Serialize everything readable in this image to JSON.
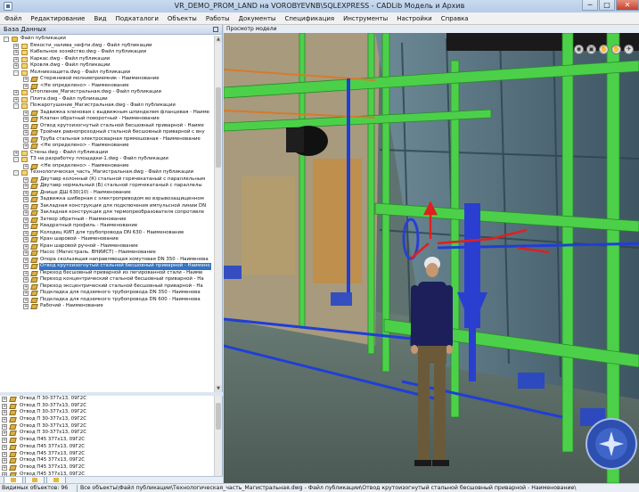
{
  "window": {
    "title": "VR_DEMO_PROM_LAND на VOROBYEVNB\\SQLEXPRESS - CADLib Модель и Архив",
    "controls": [
      "─",
      "□",
      "✕"
    ]
  },
  "menu": [
    "Файл",
    "Редактирование",
    "Вид",
    "Подкаталоги",
    "Объекты",
    "Работы",
    "Документы",
    "Спецификация",
    "Инструменты",
    "Настройки",
    "Справка"
  ],
  "left_panel": {
    "title": "База Данных",
    "tree": [
      {
        "level": 0,
        "icon": "folder",
        "exp": "-",
        "label": "Файл публикации"
      },
      {
        "level": 1,
        "icon": "dwg",
        "exp": "+",
        "label": "Емкости_налива_нефти.dwg - Файл публикации"
      },
      {
        "level": 1,
        "icon": "dwg",
        "exp": "+",
        "label": "Кабельное хозяйство.dwg - Файл публикации"
      },
      {
        "level": 1,
        "icon": "dwg",
        "exp": "+",
        "label": "Каркас.dwg - Файл публикации"
      },
      {
        "level": 1,
        "icon": "dwg",
        "exp": "+",
        "label": "Кровля.dwg - Файл публикации"
      },
      {
        "level": 1,
        "icon": "dwg",
        "exp": "-",
        "label": "Молниезащита.dwg - Файл публикации"
      },
      {
        "level": 2,
        "icon": "part",
        "exp": "+",
        "label": "Стержневой молниеприемник - Наименование"
      },
      {
        "level": 2,
        "icon": "part",
        "exp": "+",
        "label": "<Не определено> - Наименование"
      },
      {
        "level": 1,
        "icon": "dwg",
        "exp": "+",
        "label": "Отопление_Магистральная.dwg - Файл публикации"
      },
      {
        "level": 1,
        "icon": "dwg",
        "exp": "+",
        "label": "Плита.dwg - Файл публикации"
      },
      {
        "level": 1,
        "icon": "dwg",
        "exp": "-",
        "label": "Пожаротушение_Магистральная.dwg - Файл публикации"
      },
      {
        "level": 2,
        "icon": "part",
        "exp": "+",
        "label": "Задвижка клиновая с выдвижным шпинделем фланцевая - Наиме"
      },
      {
        "level": 2,
        "icon": "part",
        "exp": "+",
        "label": "Клапан обратный поворотный - Наименование"
      },
      {
        "level": 2,
        "icon": "part",
        "exp": "+",
        "label": "Отвод крутоизогнутый стальной бесшовный приварной - Наиме"
      },
      {
        "level": 2,
        "icon": "part",
        "exp": "+",
        "label": "Тройник равнопроходный стальной бесшовный приварной с вну"
      },
      {
        "level": 2,
        "icon": "part",
        "exp": "+",
        "label": "Труба стальная электросварная прямошовная - Наименование"
      },
      {
        "level": 2,
        "icon": "part",
        "exp": "+",
        "label": "<Не определено> - Наименование"
      },
      {
        "level": 1,
        "icon": "dwg",
        "exp": "+",
        "label": "Стены.dwg - Файл публикации"
      },
      {
        "level": 1,
        "icon": "dwg",
        "exp": "-",
        "label": "ТЗ на разработку площадки-1.dwg - Файл публикации"
      },
      {
        "level": 2,
        "icon": "part",
        "exp": "+",
        "label": "<Не определено> - Наименование"
      },
      {
        "level": 1,
        "icon": "dwg",
        "exp": "-",
        "label": "Технологическая_часть_Магистральная.dwg - Файл публикации"
      },
      {
        "level": 2,
        "icon": "part",
        "exp": "+",
        "label": "Двутавр колонный (К) стальной горячекатаный с параллельным"
      },
      {
        "level": 2,
        "icon": "part",
        "exp": "+",
        "label": "Двутавр нормальный (Б) стальной горячекатаный с параллелы"
      },
      {
        "level": 2,
        "icon": "part",
        "exp": "+",
        "label": "Днище ДШ 630(10) - Наименование"
      },
      {
        "level": 2,
        "icon": "part",
        "exp": "+",
        "label": "Задвижка шиберная с электроприводом во взрывозащищенном"
      },
      {
        "level": 2,
        "icon": "part",
        "exp": "+",
        "label": "Закладная конструкция для подключения импульсной линии DN"
      },
      {
        "level": 2,
        "icon": "part",
        "exp": "+",
        "label": "Закладная конструкция для термопреобразователя сопротивле"
      },
      {
        "level": 2,
        "icon": "part",
        "exp": "+",
        "label": "Затвор обратный - Наименование"
      },
      {
        "level": 2,
        "icon": "part",
        "exp": "+",
        "label": "Квадратный профиль - Наименование"
      },
      {
        "level": 2,
        "icon": "part",
        "exp": "+",
        "label": "Колодец КИП для трубопровода DN 630 - Наименование"
      },
      {
        "level": 2,
        "icon": "part",
        "exp": "+",
        "label": "Кран шаровой - Наименование"
      },
      {
        "level": 2,
        "icon": "part",
        "exp": "+",
        "label": "Кран шаровой ручной - Наименование"
      },
      {
        "level": 2,
        "icon": "part",
        "exp": "+",
        "label": "Насос (Магистраль. ВНИИСТ) - Наименование"
      },
      {
        "level": 2,
        "icon": "part",
        "exp": "+",
        "label": "Опора скользящая направляющая хомутовая DN 350 - Наименова"
      },
      {
        "level": 2,
        "icon": "part",
        "exp": "+",
        "label": "Отвод крутоизогнутый стальной бесшовный приварной - Наимено",
        "selected": true
      },
      {
        "level": 2,
        "icon": "part",
        "exp": "+",
        "label": "Переход бесшовный приварной из легированной стали - Наиме"
      },
      {
        "level": 2,
        "icon": "part",
        "exp": "+",
        "label": "Переход концентрический стальной бесшовный приварной - На"
      },
      {
        "level": 2,
        "icon": "part",
        "exp": "+",
        "label": "Переход эксцентрический стальной бесшовный приварной - На"
      },
      {
        "level": 2,
        "icon": "part",
        "exp": "+",
        "label": "Подкладка для подземного трубопровода DN 350 - Наименова"
      },
      {
        "level": 2,
        "icon": "part",
        "exp": "+",
        "label": "Подкладка для подземного трубопровода DN 600 - Наименова"
      },
      {
        "level": 2,
        "icon": "part",
        "exp": "+",
        "label": "Рабочий - Наименование"
      }
    ],
    "list": [
      "Отвод П 30-377х13, 09Г2С",
      "Отвод П 30-377х13, 09Г2С",
      "Отвод П 30-377х13, 09Г2С",
      "Отвод П 30-377х13, 09Г2С",
      "Отвод П 30-377х13, 09Г2С",
      "Отвод П 30-377х13, 09Г2С",
      "Отвод П45 377х13, 09Г2С",
      "Отвод П45 377х13, 09Г2С",
      "Отвод П45 377х13, 09Г2С",
      "Отвод П45 377х13, 09Г2С",
      "Отвод П45 377х13, 09Г2С",
      "Отвод П45 377х13, 09Г2С"
    ]
  },
  "viewport": {
    "title": "Просмотр модели",
    "tool_icons": [
      "eye-icon",
      "camera-icon",
      "walk-icon",
      "hand-icon",
      "fly-icon"
    ],
    "tool_glyphs": [
      "◉",
      "▣",
      "✋",
      "✋",
      "✈"
    ]
  },
  "status": {
    "count": "Видимых объектов: 96",
    "path": "Все объекты\\Файл публикации\\Технологическая_часть_Магистральная.dwg - Файл публикации\\Отвод крутоизогнутый стальной бесшовный приварной - Наименование\\"
  },
  "colors": {
    "selection": "#3373c4",
    "frame_green": "#4cd04a",
    "pipe_blue": "#1f3fd6",
    "accent_red": "#e02020"
  }
}
